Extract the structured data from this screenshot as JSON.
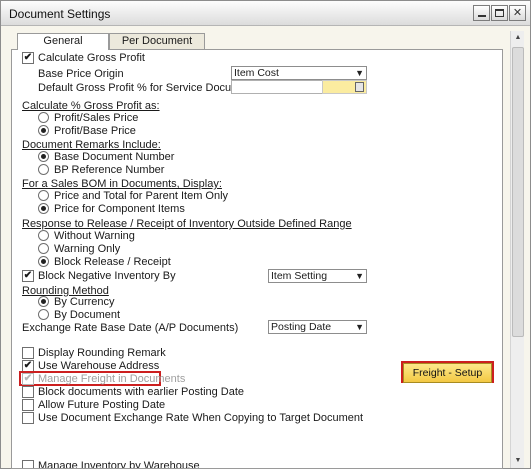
{
  "window": {
    "title": "Document Settings"
  },
  "tabs": [
    {
      "label": "General"
    },
    {
      "label": "Per Document"
    }
  ],
  "general": {
    "calc_gross_profit": {
      "label": "Calculate Gross Profit",
      "checked": true
    },
    "base_price_origin": {
      "label": "Base Price Origin",
      "value": "Item Cost"
    },
    "default_gp_service": {
      "label": "Default Gross Profit % for Service Documents"
    },
    "calc_pct_section": {
      "title": "Calculate % Gross Profit as:",
      "options": [
        {
          "label": "Profit/Sales Price",
          "selected": false
        },
        {
          "label": "Profit/Base Price",
          "selected": true
        }
      ]
    },
    "doc_remarks_section": {
      "title": "Document Remarks Include:",
      "options": [
        {
          "label": "Base Document Number",
          "selected": true
        },
        {
          "label": "BP Reference Number",
          "selected": false
        }
      ]
    },
    "sales_bom_section": {
      "title": "For a Sales BOM in Documents, Display:",
      "options": [
        {
          "label": "Price and Total for Parent Item Only",
          "selected": false
        },
        {
          "label": "Price for Component Items",
          "selected": true
        }
      ]
    },
    "release_section": {
      "title": "Response to Release / Receipt of Inventory Outside Defined Range",
      "options": [
        {
          "label": "Without Warning",
          "selected": false
        },
        {
          "label": "Warning Only",
          "selected": false
        },
        {
          "label": "Block Release / Receipt",
          "selected": true
        }
      ]
    },
    "block_negative": {
      "label": "Block Negative Inventory By",
      "checked": true,
      "value": "Item Setting"
    },
    "rounding_section": {
      "title": "Rounding Method",
      "options": [
        {
          "label": "By Currency",
          "selected": true
        },
        {
          "label": "By Document",
          "selected": false
        }
      ]
    },
    "exchange_rate": {
      "label": "Exchange Rate Base Date (A/P Documents)",
      "value": "Posting Date"
    },
    "checkboxes": [
      {
        "label": "Display Rounding Remark",
        "checked": false
      },
      {
        "label": "Use Warehouse Address",
        "checked": true
      },
      {
        "label": "Manage Freight in Documents",
        "checked": true,
        "disabled": true
      },
      {
        "label": "Block documents with earlier Posting Date",
        "checked": false
      },
      {
        "label": "Allow Future Posting Date",
        "checked": false
      },
      {
        "label": "Use Document Exchange Rate When Copying to Target Document",
        "checked": false
      }
    ],
    "freight_setup_button": {
      "label": "Freight - Setup"
    },
    "cutoff_label": {
      "label": "Manage Inventory by Warehouse"
    }
  }
}
